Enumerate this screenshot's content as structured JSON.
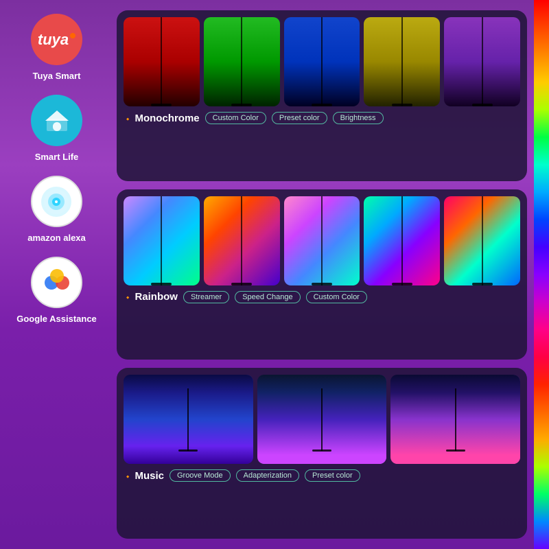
{
  "sidebar": {
    "items": [
      {
        "id": "tuya",
        "label": "Tuya Smart",
        "icon": "tuya-icon"
      },
      {
        "id": "smartlife",
        "label": "Smart Life",
        "icon": "smartlife-icon"
      },
      {
        "id": "alexa",
        "label": "amazon alexa",
        "icon": "alexa-icon"
      },
      {
        "id": "google",
        "label": "Google Assistance",
        "icon": "google-icon"
      }
    ]
  },
  "sections": [
    {
      "id": "monochrome",
      "title": "Monochrome",
      "tags": [
        "Custom Color",
        "Preset color",
        "Brightness"
      ],
      "lamps": [
        "red",
        "green",
        "blue",
        "yellow",
        "purple"
      ]
    },
    {
      "id": "rainbow",
      "title": "Rainbow",
      "tags": [
        "Streamer",
        "Speed Change",
        "Custom Color"
      ],
      "lamps": [
        "rainbow1",
        "rainbow2",
        "rainbow3",
        "rainbow4",
        "rainbow5"
      ]
    },
    {
      "id": "music",
      "title": "Music",
      "tags": [
        "Groove Mode",
        "Adapterization",
        "Preset color"
      ]
    }
  ]
}
